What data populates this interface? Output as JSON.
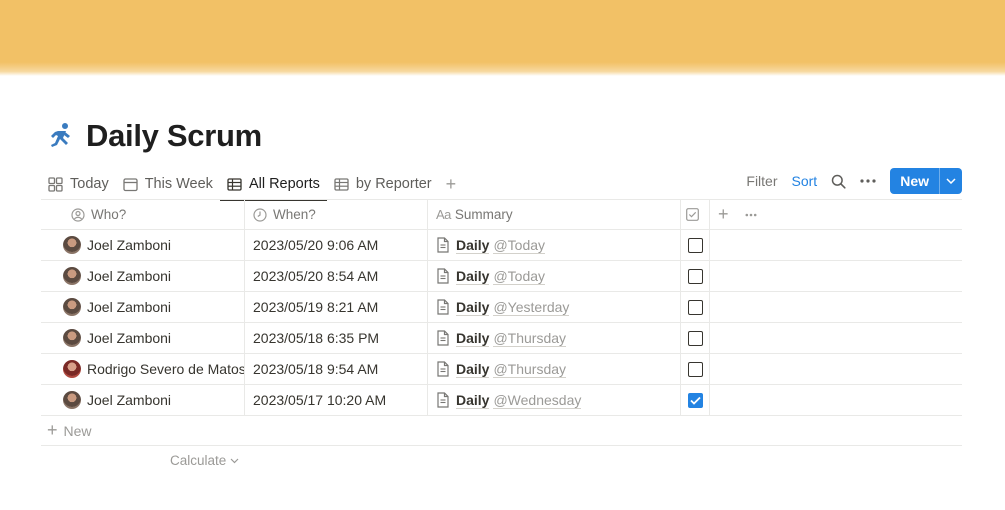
{
  "page": {
    "title": "Daily Scrum",
    "icon": "running-person-icon",
    "cover_color": "#f2c166"
  },
  "views": [
    {
      "label": "Today",
      "icon": "gallery-icon",
      "active": false
    },
    {
      "label": "This Week",
      "icon": "calendar-icon",
      "active": false
    },
    {
      "label": "All Reports",
      "icon": "table-icon",
      "active": true
    },
    {
      "label": "by Reporter",
      "icon": "table-icon",
      "active": false
    }
  ],
  "toolbar": {
    "filter_label": "Filter",
    "sort_label": "Sort",
    "new_label": "New",
    "accent_color": "#2383e2"
  },
  "table": {
    "columns": [
      {
        "label": "Who?",
        "icon": "person-icon"
      },
      {
        "label": "When?",
        "icon": "clock-icon"
      },
      {
        "label": "Summary",
        "icon": "text-icon"
      },
      {
        "label": "",
        "icon": "checkbox-icon"
      }
    ],
    "rows": [
      {
        "who": "Joel Zamboni",
        "when": "2023/05/20 9:06 AM",
        "summary": "Daily",
        "mention": "@Today",
        "done": false
      },
      {
        "who": "Joel Zamboni",
        "when": "2023/05/20 8:54 AM",
        "summary": "Daily",
        "mention": "@Today",
        "done": false
      },
      {
        "who": "Joel Zamboni",
        "when": "2023/05/19 8:21 AM",
        "summary": "Daily",
        "mention": "@Yesterday",
        "done": false
      },
      {
        "who": "Joel Zamboni",
        "when": "2023/05/18 6:35 PM",
        "summary": "Daily",
        "mention": "@Thursday",
        "done": false
      },
      {
        "who": "Rodrigo Severo de Matos",
        "when": "2023/05/18 9:54 AM",
        "summary": "Daily",
        "mention": "@Thursday",
        "done": false
      },
      {
        "who": "Joel Zamboni",
        "when": "2023/05/17 10:20 AM",
        "summary": "Daily",
        "mention": "@Wednesday",
        "done": true
      }
    ],
    "new_row_label": "New",
    "calculate_label": "Calculate"
  }
}
